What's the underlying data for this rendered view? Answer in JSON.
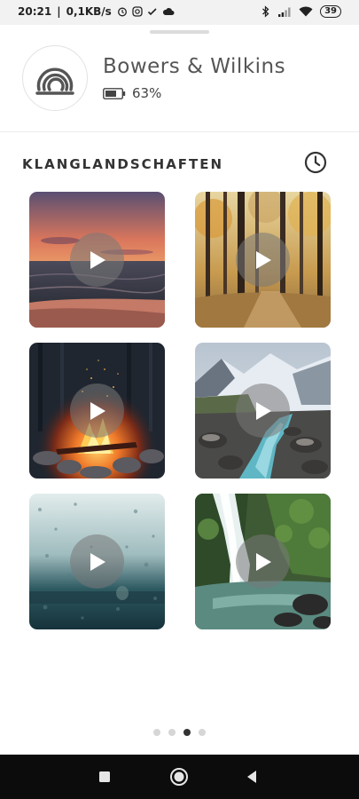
{
  "status_bar": {
    "time": "20:21",
    "speed": "0,1KB/s",
    "battery": "39"
  },
  "device": {
    "name": "Bowers & Wilkins",
    "battery": "63%"
  },
  "section": {
    "title": "KLANGLANDSCHAFTEN"
  },
  "pager": {
    "pages": 4,
    "active_index": 2
  },
  "colors": {
    "accent_text": "#333333",
    "nav_background": "#0c0c0c",
    "status_background": "#f2f2f2"
  }
}
